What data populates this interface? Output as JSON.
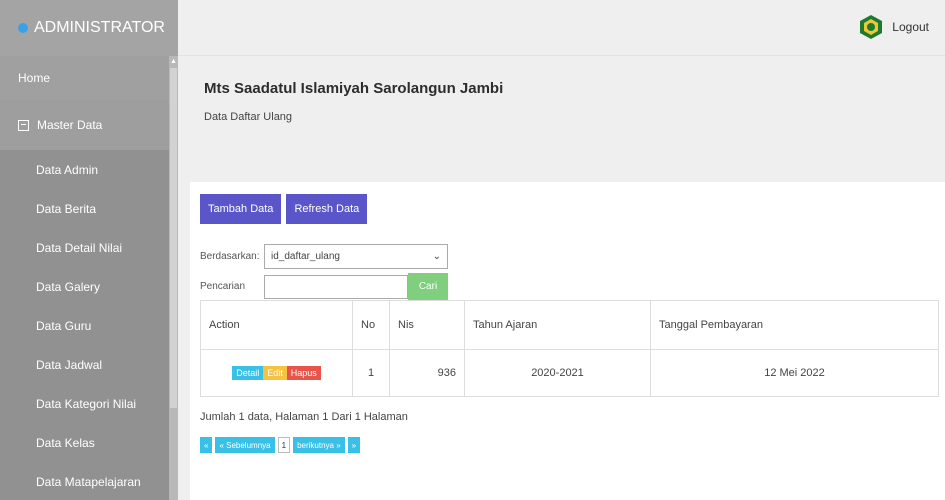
{
  "brand": {
    "title": "ADMINISTRATOR"
  },
  "topbar": {
    "logout_label": "Logout"
  },
  "sidebar": {
    "home": "Home",
    "master": "Master Data",
    "items": [
      {
        "label": "Data Admin"
      },
      {
        "label": "Data Berita"
      },
      {
        "label": "Data Detail Nilai"
      },
      {
        "label": "Data Galery"
      },
      {
        "label": "Data Guru"
      },
      {
        "label": "Data Jadwal"
      },
      {
        "label": "Data Kategori Nilai"
      },
      {
        "label": "Data Kelas"
      },
      {
        "label": "Data Matapelajaran"
      }
    ]
  },
  "main": {
    "site_title": "Mts Saadatul Islamiyah Sarolangun Jambi",
    "page_subtitle": "Data Daftar Ulang",
    "buttons": {
      "add": "Tambah Data",
      "refresh": "Refresh Data"
    },
    "filter": {
      "label": "Berdasarkan:",
      "selected": "id_daftar_ulang",
      "search_label": "Pencarian",
      "search_value": "",
      "search_button": "Cari"
    },
    "table": {
      "headers": [
        "Action",
        "No",
        "Nis",
        "Tahun Ajaran",
        "Tanggal Pembayaran"
      ],
      "rows": [
        {
          "actions": {
            "detail": "Detail",
            "edit": "Edit",
            "hapus": "Hapus"
          },
          "no": "1",
          "nis": "936",
          "tahun_ajaran": "2020-2021",
          "tanggal": "12 Mei 2022"
        }
      ]
    },
    "summary": "Jumlah 1 data, Halaman 1 Dari 1 Halaman",
    "pager": {
      "first": "«",
      "prev": "« Sebelumnya",
      "current": "1",
      "next": "berikutnya »",
      "last": "»"
    }
  },
  "colors": {
    "primary_button": "#5a55c8",
    "search_button": "#7fcf7f",
    "detail": "#38c0e6",
    "edit": "#f5c242",
    "hapus": "#e8544a"
  },
  "icons": {
    "brand": "dot-icon",
    "master": "table-icon",
    "logo": "school-logo",
    "select": "chevron-down-icon"
  }
}
